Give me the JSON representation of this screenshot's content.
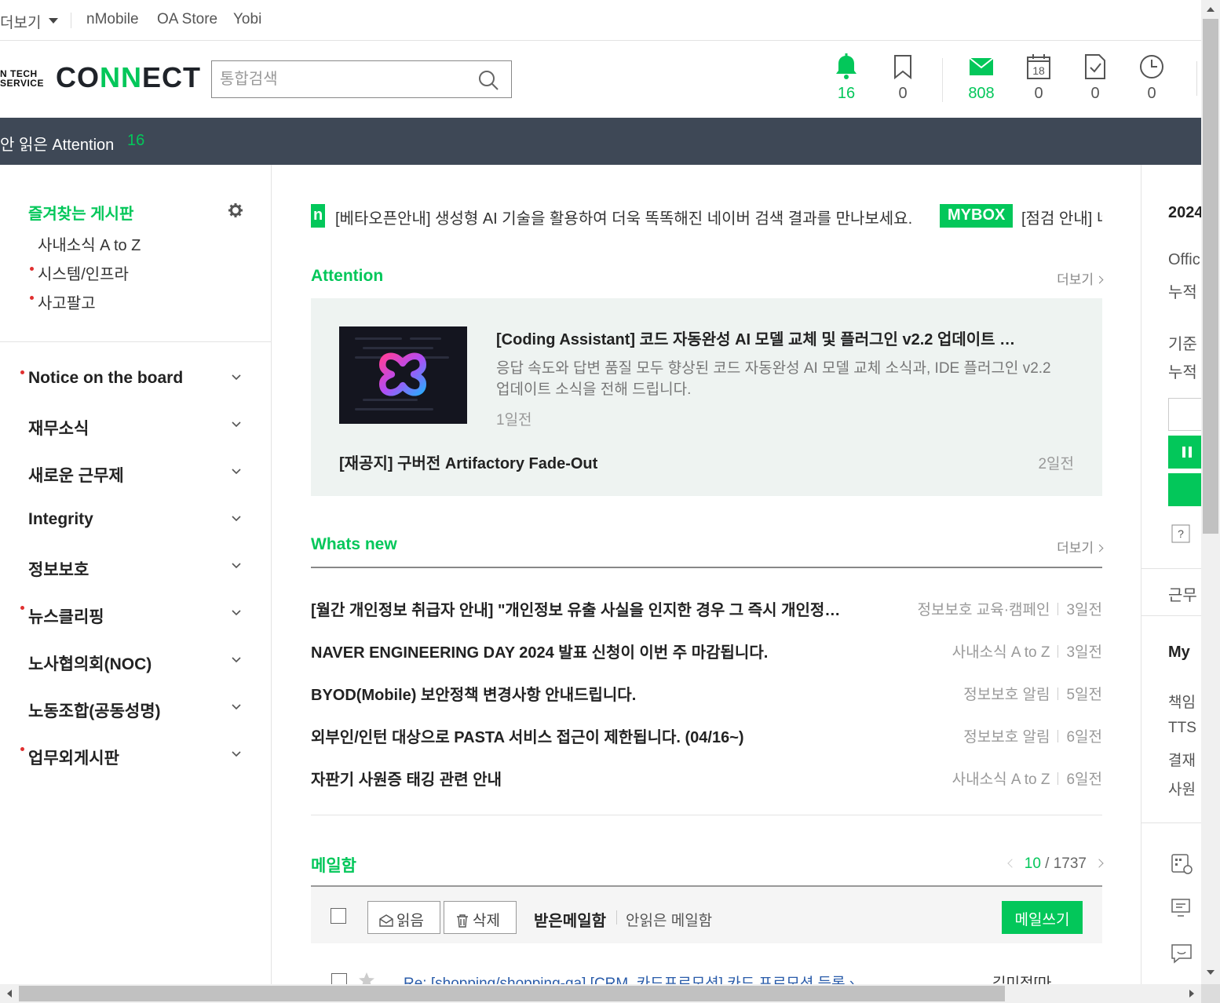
{
  "toplinks": {
    "more": "더보기",
    "links": [
      "nMobile",
      "OA Store",
      "Yobi"
    ]
  },
  "header": {
    "logo_small_1": "N TECH",
    "logo_small_2": "SERVICE",
    "logo_a": "CO",
    "logo_b": "NN",
    "logo_c": "ECT",
    "search_placeholder": "통합검색",
    "counts": {
      "attention": "16",
      "bookmark": "0",
      "mail": "808",
      "calendar": "0",
      "approval": "0",
      "clock": "0"
    },
    "calendar_day": "18"
  },
  "bar": {
    "text": "안 읽은 Attention",
    "count": "16"
  },
  "sidebar": {
    "fav_title": "즐겨찾는 게시판",
    "fav_items": [
      "사내소식 A to Z",
      "시스템/인프라",
      "사고팔고"
    ],
    "menu": [
      "Notice on the board",
      "재무소식",
      "새로운 근무제",
      "Integrity",
      "정보보호",
      "뉴스클리핑",
      "노사협의회(NOC)",
      "노동조합(공동성명)",
      "업무외게시판"
    ]
  },
  "ticker": {
    "tag1": "n",
    "text1": "[베타오픈안내] 생성형 AI 기술을 활용하여 더욱 똑똑해진 네이버 검색 결과를 만나보세요.",
    "tag2": "MYBOX",
    "text2": "[점검 안내] 네"
  },
  "attention": {
    "title": "Attention",
    "more": "더보기",
    "item1_title": "[Coding Assistant] 코드 자동완성 AI 모델 교체 및 플러그인 v2.2 업데이트 …",
    "item1_desc": "응답 속도와 답변 품질 모두 향상된 코드 자동완성 AI 모델 교체 소식과, IDE 플러그인 v2.2 업데이트 소식을 전해 드립니다.",
    "item1_time": "1일전",
    "item2_title": "[재공지] 구버전 Artifactory Fade-Out",
    "item2_time": "2일전"
  },
  "whatsnew": {
    "title": "Whats new",
    "more": "더보기",
    "rows": [
      {
        "title": "[월간 개인정보 취급자 안내] \"개인정보 유출 사실을 인지한 경우 그 즉시 개인정…",
        "board": "정보보호 교육·캠페인",
        "time": "3일전"
      },
      {
        "title": "NAVER ENGINEERING DAY 2024 발표 신청이 이번 주 마감됩니다.",
        "board": "사내소식 A to Z",
        "time": "3일전"
      },
      {
        "title": "BYOD(Mobile) 보안정책 변경사항 안내드립니다.",
        "board": "정보보호 알림",
        "time": "5일전"
      },
      {
        "title": "외부인/인턴 대상으로 PASTA 서비스 접근이 제한됩니다. (04/16~)",
        "board": "정보보호 알림",
        "time": "6일전"
      },
      {
        "title": "자판기 사원증 태깅 관련 안내",
        "board": "사내소식 A to Z",
        "time": "6일전"
      }
    ]
  },
  "mailbox": {
    "title": "메일함",
    "page_current": "10",
    "page_total": "/ 1737",
    "read_btn": "읽음",
    "delete_btn": "삭제",
    "inbox": "받은메일함",
    "unread": "안읽은 메일함",
    "write": "메일쓰기",
    "row_subject": "Re: [shopping/shopping-qa] [CRM_카드프로모션] 카드 프로모션 등록 › …",
    "row_from": "김미정[마…"
  },
  "rpanel": {
    "year": "2024",
    "office": "Offic",
    "acc1": "누적",
    "basis": "기준",
    "acc2": "누적",
    "work": "근무",
    "my": "My",
    "links": [
      "책임",
      "TTS",
      "결재",
      "사원"
    ]
  },
  "colors": {
    "accent": "#03c75a",
    "bar": "#3e4856"
  }
}
